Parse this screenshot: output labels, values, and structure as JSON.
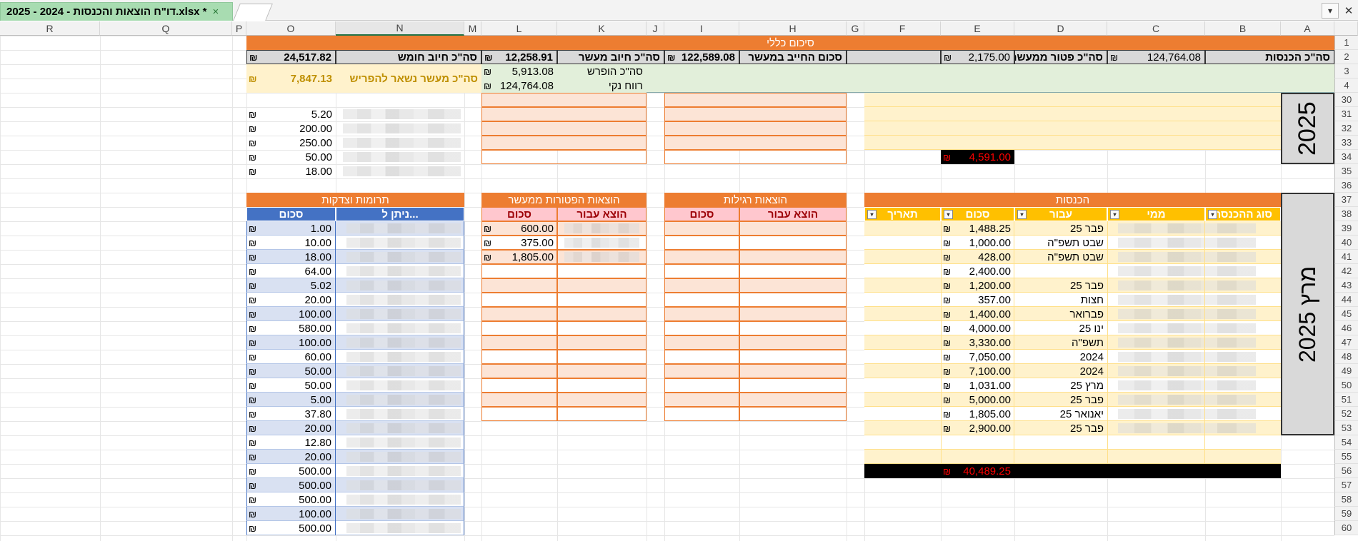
{
  "file_tab": {
    "title": "דו\"ח הוצאות והכנסות - 2024 - 2025.xlsx *",
    "close": "×",
    "scroll_down": "▾",
    "close_window": "✕"
  },
  "columns": [
    "A",
    "B",
    "C",
    "D",
    "E",
    "F",
    "G",
    "H",
    "I",
    "J",
    "K",
    "L",
    "M",
    "N",
    "O",
    "P",
    "Q",
    "R"
  ],
  "rows": [
    "1",
    "2",
    "3",
    "4",
    "30",
    "31",
    "32",
    "33",
    "34",
    "35",
    "36",
    "37",
    "38",
    "39",
    "40",
    "41",
    "42",
    "43",
    "44",
    "45",
    "46",
    "47",
    "48",
    "49",
    "50",
    "51",
    "52",
    "53",
    "54",
    "55",
    "56",
    "57",
    "58",
    "59",
    "60"
  ],
  "summary": {
    "title": "סיכום כללי",
    "total_income_label": "סה\"כ הכנסות",
    "total_income_value": "124,764.08",
    "exempt_label": "סה\"כ פטור ממעשר",
    "exempt_value": "2,175.00",
    "liable_label": "סכום החייב במעשר",
    "liable_value": "122,589.08",
    "tithe_label": "סה\"כ חיוב מעשר",
    "tithe_value": "12,258.91",
    "fifth_label": "סה\"כ חיוב חומש",
    "fifth_value": "24,517.82",
    "separated_label": "סה\"כ הופרש",
    "separated_value": "5,913.08",
    "profit_label": "רווח נקי",
    "profit_value": "124,764.08",
    "remaining_label": "סה\"כ מעשר נשאר להפריש",
    "remaining_value": "7,847.13",
    "currency": "₪"
  },
  "sections": {
    "month_upper": "2025",
    "month_label": "מרץ 2025",
    "income": "הכנסות",
    "regular": "הוצאות רגילות",
    "exempt": "הוצאות הפטורות ממעשר",
    "donations": "תרומות וצדקות"
  },
  "income_headers": {
    "type": "סוג ההכנסה",
    "from": "ממי",
    "for": "עבור",
    "amount": "סכום",
    "date": "תאריך"
  },
  "expense_headers": {
    "for": "הוצא עבור",
    "amount": "סכום"
  },
  "donation_headers": {
    "to": "ניתן ל...",
    "amount": "סכום"
  },
  "upper_donations": [
    "5.20",
    "200.00",
    "250.00",
    "50.00",
    "18.00"
  ],
  "upper_income_total": "4,591.00",
  "income_rows": [
    {
      "for": "פבר 25",
      "amount": "1,488.25"
    },
    {
      "for": "שבט תשפ\"ה",
      "amount": "1,000.00"
    },
    {
      "for": "שבט תשפ\"ה",
      "amount": "428.00"
    },
    {
      "for": "",
      "amount": "2,400.00"
    },
    {
      "for": "פבר 25",
      "amount": "1,200.00"
    },
    {
      "for": "חצות",
      "amount": "357.00"
    },
    {
      "for": "פברואר",
      "amount": "1,400.00"
    },
    {
      "for": "ינו 25",
      "amount": "4,000.00"
    },
    {
      "for": "תשפ\"ה",
      "amount": "3,330.00"
    },
    {
      "for": "2024",
      "amount": "7,050.00"
    },
    {
      "for": "2024",
      "amount": "7,100.00"
    },
    {
      "for": "מרץ 25",
      "amount": "1,031.00"
    },
    {
      "for": "פבר 25",
      "amount": "5,000.00"
    },
    {
      "for": "יאנואר 25",
      "amount": "1,805.00"
    },
    {
      "for": "פבר 25",
      "amount": "2,900.00"
    }
  ],
  "income_total": "40,489.25",
  "exempt_rows": [
    "600.00",
    "375.00",
    "1,805.00"
  ],
  "donation_rows": [
    "1.00",
    "10.00",
    "18.00",
    "64.00",
    "5.02",
    "20.00",
    "100.00",
    "580.00",
    "100.00",
    "60.00",
    "50.00",
    "50.00",
    "5.00",
    "37.80",
    "20.00",
    "12.80",
    "20.00",
    "500.00",
    "500.00",
    "500.00",
    "100.00",
    "500.00"
  ],
  "colors": {
    "orange": "#ed7d31",
    "yellow_header": "#ffc000",
    "pink_header": "#ffc7ce",
    "blue_header": "#4472c4",
    "summary_green": "#e2efda",
    "black_total": "#000000",
    "red_text": "#ff0000"
  }
}
